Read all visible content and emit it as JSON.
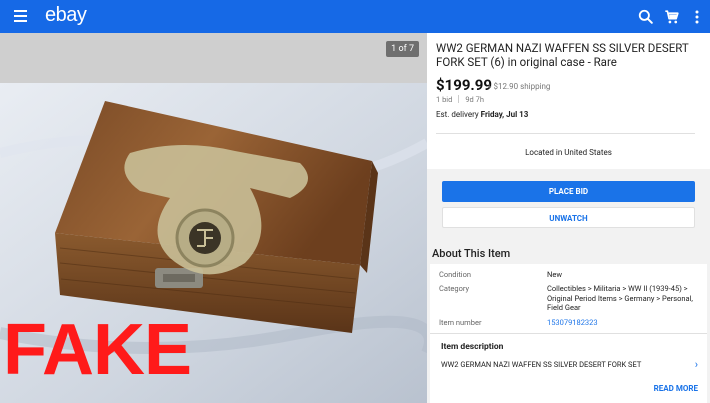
{
  "app": {
    "logo": "ebay"
  },
  "photo": {
    "counter": "1 of 7",
    "overlay_label": "FAKE"
  },
  "listing": {
    "title": "WW2 GERMAN NAZI WAFFEN SS SILVER DESERT FORK SET (6) in original case - Rare",
    "price": "$199.99",
    "shipping": "+ $12.90 shipping",
    "bids": "1 bid",
    "time_left": "9d 7h",
    "delivery_prefix": "Est. delivery ",
    "delivery_date": "Friday, Jul 13",
    "location": "Located in United States"
  },
  "actions": {
    "place_bid": "PLACE BID",
    "unwatch": "UNWATCH"
  },
  "about": {
    "heading": "About This Item",
    "condition_label": "Condition",
    "condition_value": "New",
    "category_label": "Category",
    "category_value": "Collectibles > Militaria > WW II (1939-45) > Original Period Items > Germany > Personal, Field Gear",
    "item_number_label": "Item number",
    "item_number_value": "153079182323",
    "desc_heading": "Item description",
    "desc_text": "WW2 GERMAN NAZI WAFFEN SS SILVER DESERT FORK SET",
    "read_more": "READ MORE"
  },
  "colors": {
    "brand_blue": "#1669e6",
    "link_blue": "#1a73e8",
    "fake_red": "#ff1a1a"
  }
}
